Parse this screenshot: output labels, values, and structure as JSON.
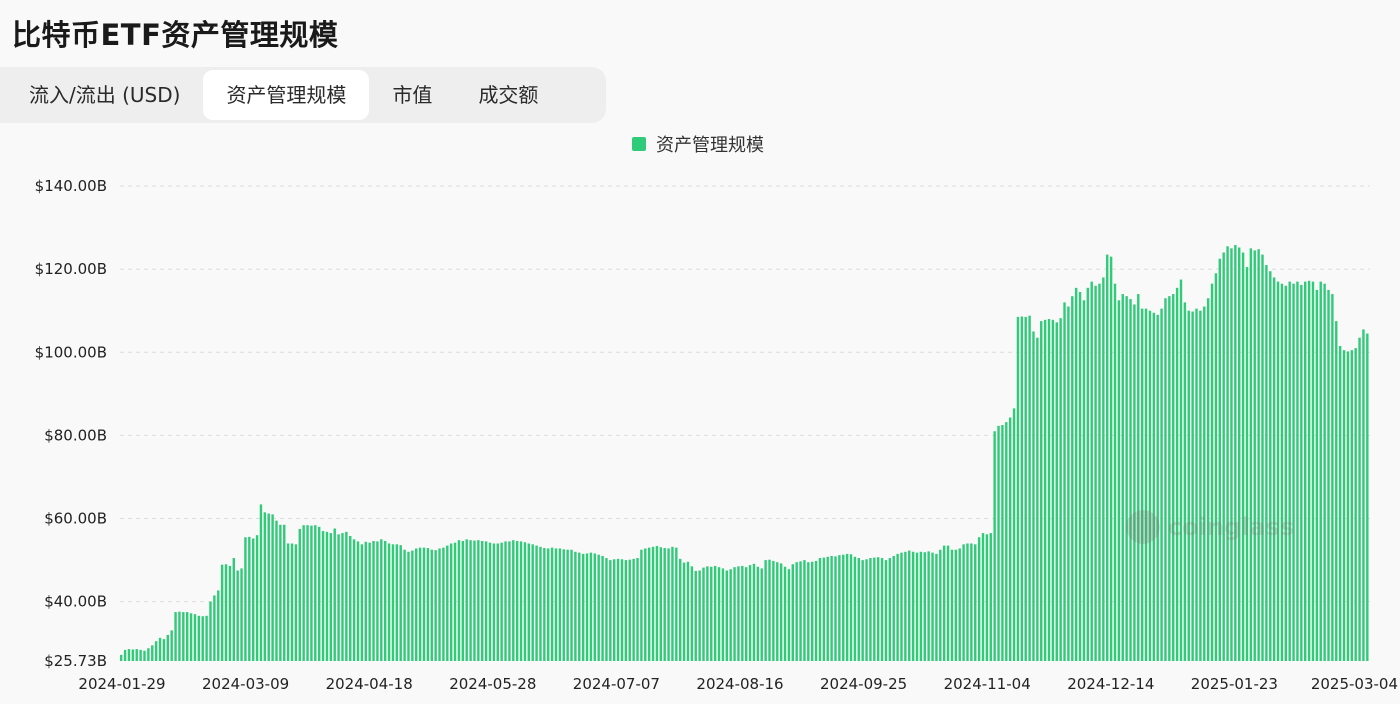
{
  "page_title": "比特币ETF资产管理规模",
  "tabs": [
    {
      "label": "流入/流出 (USD)",
      "active": false
    },
    {
      "label": "资产管理规模",
      "active": true
    },
    {
      "label": "市值",
      "active": false
    },
    {
      "label": "成交额",
      "active": false
    }
  ],
  "watermark": "coinglass",
  "chart_data": {
    "type": "bar",
    "legend": [
      {
        "label": "资产管理规模",
        "color": "#2fcb79"
      }
    ],
    "legend_position": "top-center",
    "grid": true,
    "y_ticks": [
      {
        "value": 25.73,
        "label": "$25.73B"
      },
      {
        "value": 40,
        "label": "$40.00B"
      },
      {
        "value": 60,
        "label": "$60.00B"
      },
      {
        "value": 80,
        "label": "$80.00B"
      },
      {
        "value": 100,
        "label": "$100.00B"
      },
      {
        "value": 120,
        "label": "$120.00B"
      },
      {
        "value": 140,
        "label": "$140.00B"
      }
    ],
    "ylim": [
      25.73,
      140
    ],
    "x_ticks": [
      "2024-01-29",
      "2024-03-09",
      "2024-04-18",
      "2024-05-28",
      "2024-07-07",
      "2024-08-16",
      "2024-09-25",
      "2024-11-04",
      "2024-12-14",
      "2025-01-23",
      "2025-03-04"
    ],
    "series": [
      {
        "name": "资产管理规模",
        "values": [
          27.2,
          28.4,
          28.6,
          28.5,
          28.6,
          28.4,
          28.2,
          28.8,
          29.5,
          30.5,
          31.3,
          31.0,
          32.0,
          33.1,
          37.5,
          37.6,
          37.5,
          37.5,
          37.2,
          37.0,
          36.6,
          36.5,
          36.6,
          40.0,
          41.5,
          42.7,
          48.9,
          49.0,
          48.6,
          50.5,
          47.5,
          48.0,
          55.5,
          55.6,
          55.2,
          56.0,
          63.4,
          61.5,
          61.2,
          61.0,
          59.5,
          58.5,
          58.5,
          54.0,
          54.0,
          53.8,
          57.5,
          58.4,
          58.4,
          58.3,
          58.4,
          58.0,
          57.0,
          56.8,
          56.5,
          57.6,
          56.2,
          56.5,
          56.8,
          55.8,
          55.0,
          54.5,
          53.8,
          54.4,
          54.2,
          54.6,
          54.5,
          55.0,
          54.6,
          54.0,
          53.8,
          53.8,
          53.6,
          52.5,
          52.0,
          52.3,
          52.8,
          53.0,
          53.0,
          52.9,
          52.5,
          52.4,
          52.8,
          53.0,
          53.5,
          54.0,
          54.2,
          54.8,
          54.6,
          55.0,
          54.8,
          54.7,
          54.8,
          54.6,
          54.5,
          54.2,
          54.0,
          54.0,
          54.2,
          54.5,
          54.5,
          54.8,
          54.6,
          54.5,
          54.3,
          54.0,
          53.8,
          53.5,
          53.2,
          52.9,
          52.8,
          53.0,
          52.8,
          52.8,
          52.6,
          52.5,
          52.5,
          52.0,
          51.8,
          51.5,
          51.6,
          51.8,
          51.6,
          51.3,
          51.0,
          50.5,
          50.0,
          50.2,
          50.3,
          50.2,
          50.0,
          50.1,
          50.3,
          50.5,
          52.5,
          52.8,
          53.0,
          53.2,
          53.4,
          53.1,
          52.9,
          52.8,
          53.2,
          53.0,
          50.3,
          49.4,
          49.6,
          48.5,
          47.4,
          47.5,
          48.2,
          48.5,
          48.4,
          48.6,
          48.3,
          48.0,
          47.5,
          47.8,
          48.3,
          48.5,
          48.6,
          48.3,
          48.8,
          49.1,
          48.4,
          48.0,
          50.0,
          50.1,
          49.8,
          49.5,
          49.2,
          48.4,
          47.8,
          49.0,
          49.5,
          49.7,
          50.0,
          49.5,
          49.6,
          49.8,
          50.5,
          50.6,
          50.8,
          51.0,
          50.9,
          51.2,
          51.3,
          51.5,
          51.4,
          50.8,
          50.5,
          50.0,
          50.2,
          50.5,
          50.6,
          50.7,
          50.5,
          50.0,
          50.5,
          51.0,
          51.5,
          51.8,
          52.0,
          52.3,
          52.0,
          51.8,
          52.0,
          51.9,
          52.1,
          51.8,
          51.5,
          52.5,
          53.5,
          53.5,
          52.5,
          52.5,
          52.8,
          53.8,
          54.0,
          54.0,
          53.8,
          55.5,
          56.5,
          56.2,
          56.5,
          81.0,
          82.3,
          82.5,
          83.2,
          84.3,
          86.5,
          108.5,
          108.6,
          108.5,
          108.8,
          105.0,
          103.5,
          107.5,
          107.8,
          108.0,
          107.8,
          107.2,
          108.2,
          112.0,
          111.0,
          113.5,
          115.5,
          114.5,
          112.5,
          115.5,
          117.0,
          116.0,
          116.5,
          118.0,
          123.5,
          123.0,
          116.5,
          112.5,
          114.0,
          113.5,
          112.8,
          111.5,
          114.0,
          110.5,
          110.5,
          110.0,
          109.5,
          109.0,
          110.5,
          113.0,
          113.5,
          114.0,
          115.5,
          117.5,
          112.0,
          110.0,
          109.8,
          110.5,
          110.0,
          111.0,
          113.0,
          116.5,
          119.0,
          122.5,
          124.0,
          125.5,
          125.0,
          125.8,
          125.2,
          124.0,
          120.5,
          125.0,
          124.5,
          124.8,
          123.5,
          121.0,
          119.5,
          118.0,
          117.0,
          116.5,
          116.0,
          117.0,
          116.5,
          117.0,
          116.2,
          117.0,
          117.2,
          117.0,
          115.0,
          117.0,
          116.5,
          115.0,
          114.0,
          107.5,
          101.5,
          100.5,
          100.2,
          100.5,
          101.0,
          103.5,
          105.5,
          104.5
        ]
      }
    ]
  }
}
